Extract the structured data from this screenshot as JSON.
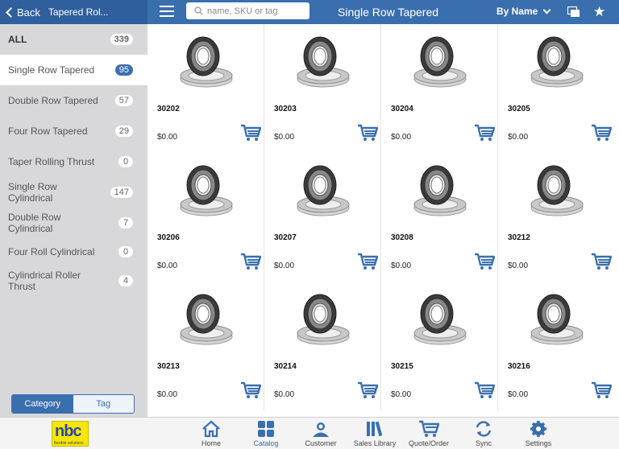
{
  "header": {
    "back_label": "Back",
    "back_title": "Tapered Rol...",
    "search_placeholder": "name, SKU or tag",
    "page_title": "Single Row Tapered",
    "sort_label": "By Name"
  },
  "sidebar": {
    "categories": [
      {
        "label": "ALL",
        "count": "339"
      },
      {
        "label": "Single Row Tapered",
        "count": "95"
      },
      {
        "label": "Double Row Tapered",
        "count": "57"
      },
      {
        "label": "Four Row Tapered",
        "count": "29"
      },
      {
        "label": "Taper Rolling Thrust",
        "count": "0"
      },
      {
        "label": "Single Row Cylindrical",
        "count": "147"
      },
      {
        "label": "Double Row Cylindrical",
        "count": "7"
      },
      {
        "label": "Four Roll Cylindrical",
        "count": "0"
      },
      {
        "label": "Cylindrical Roller Thrust",
        "count": "4"
      }
    ],
    "segment": {
      "category": "Category",
      "tag": "Tag"
    }
  },
  "products": [
    {
      "sku": "30202",
      "price": "$0.00"
    },
    {
      "sku": "30203",
      "price": "$0.00"
    },
    {
      "sku": "30204",
      "price": "$0.00"
    },
    {
      "sku": "30205",
      "price": "$0.00"
    },
    {
      "sku": "30206",
      "price": "$0.00"
    },
    {
      "sku": "30207",
      "price": "$0.00"
    },
    {
      "sku": "30208",
      "price": "$0.00"
    },
    {
      "sku": "30212",
      "price": "$0.00"
    },
    {
      "sku": "30213",
      "price": "$0.00"
    },
    {
      "sku": "30214",
      "price": "$0.00"
    },
    {
      "sku": "30215",
      "price": "$0.00"
    },
    {
      "sku": "30216",
      "price": "$0.00"
    }
  ],
  "logo": {
    "text": "nbc",
    "sub": "flexible solutions"
  },
  "tabs": [
    {
      "label": "Home",
      "icon": "home-icon"
    },
    {
      "label": "Catalog",
      "icon": "catalog-icon"
    },
    {
      "label": "Customer",
      "icon": "customer-icon"
    },
    {
      "label": "Sales Library",
      "icon": "sales-library-icon"
    },
    {
      "label": "Quote/Order",
      "icon": "quote-order-icon"
    },
    {
      "label": "Sync",
      "icon": "sync-icon"
    },
    {
      "label": "Settings",
      "icon": "settings-icon"
    }
  ],
  "colors": {
    "accent": "#3a6fae",
    "sidebar_bg": "#d8d8da"
  }
}
